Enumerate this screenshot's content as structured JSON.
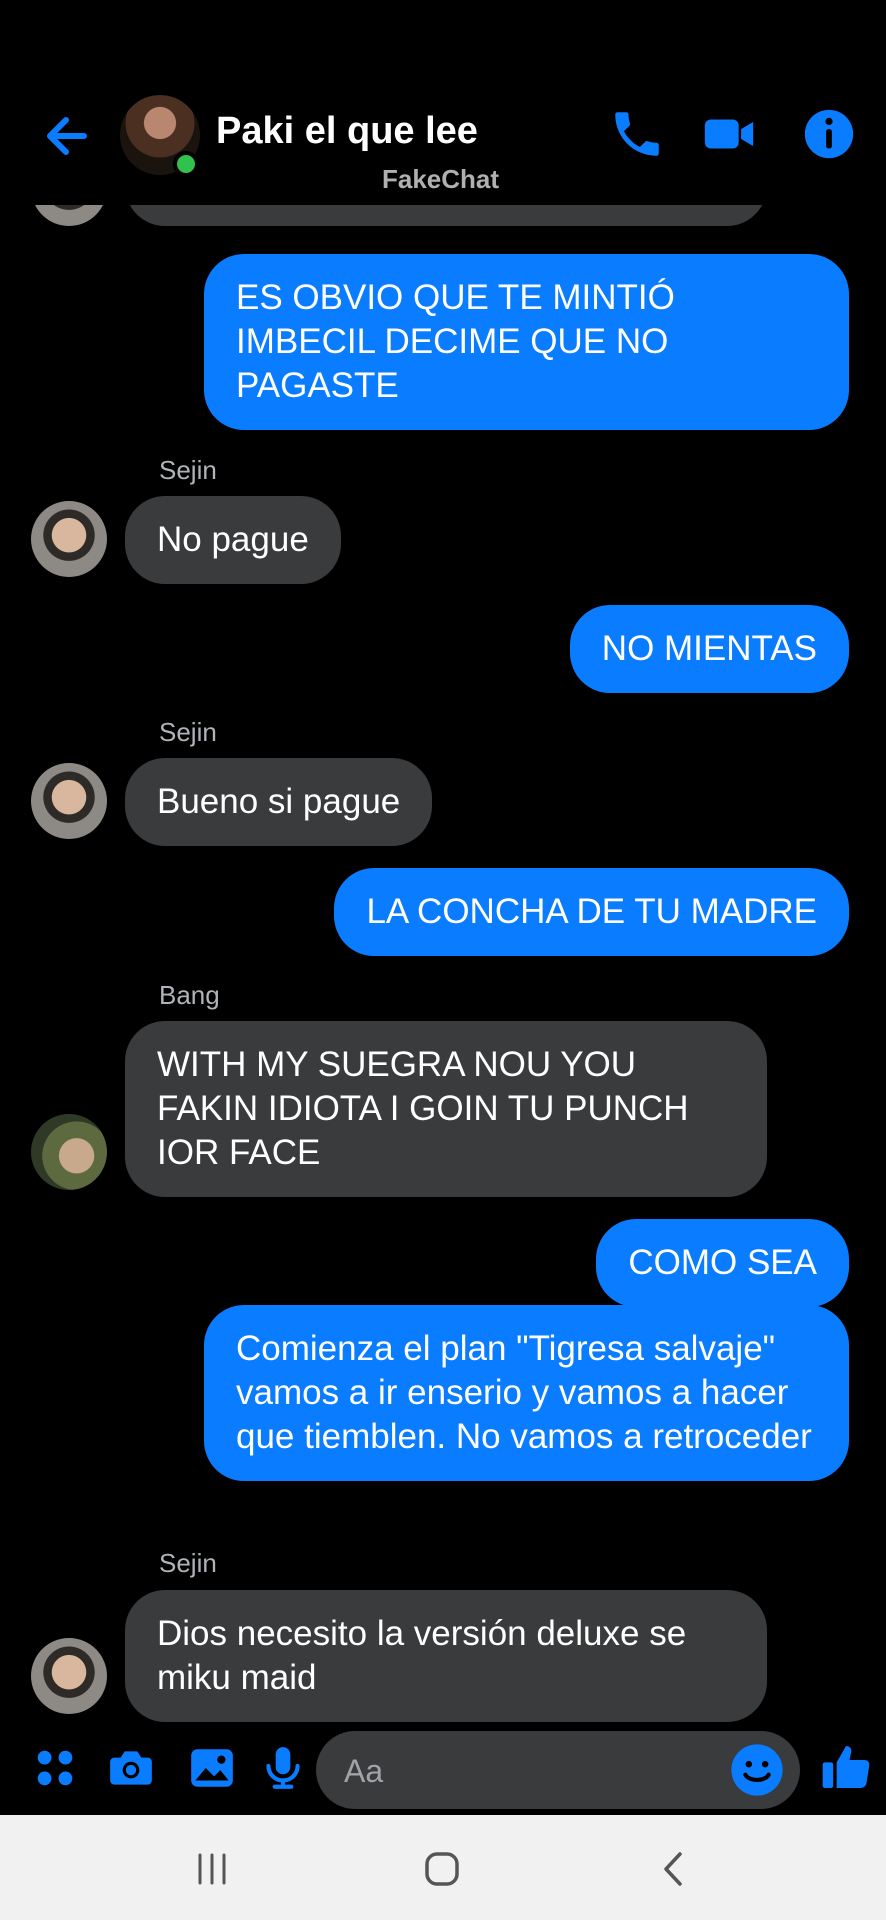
{
  "header": {
    "title": "Paki el que lee",
    "watermark": "FakeChat",
    "icons": [
      "back-arrow-icon",
      "phone-icon",
      "video-camera-icon",
      "info-icon"
    ],
    "accent": "#0a7cff"
  },
  "messages": [
    {
      "dir": "out",
      "text": "ES OBVIO QUE TE MINTIÓ IMBECIL DECIME QUE NO PAGASTE"
    },
    {
      "dir": "in",
      "sender": "Sejin",
      "text": "No pague"
    },
    {
      "dir": "out",
      "text": "NO MIENTAS"
    },
    {
      "dir": "in",
      "sender": "Sejin",
      "text": "Bueno si pague"
    },
    {
      "dir": "out",
      "text": "LA CONCHA DE TU MADRE"
    },
    {
      "dir": "in",
      "sender": "Bang",
      "text": "WITH MY SUEGRA NOU YOU FAKIN IDIOTA I GOIN TU PUNCH IOR FACE"
    },
    {
      "dir": "out",
      "text": "COMO SEA"
    },
    {
      "dir": "out",
      "text": "Comienza el plan \"Tigresa salvaje\" vamos a ir enserio y vamos a hacer que tiemblen. No vamos a retroceder"
    },
    {
      "dir": "in",
      "sender": "Sejin",
      "text": "Dios necesito la versión deluxe se miku maid"
    }
  ],
  "composer": {
    "placeholder": "Aa",
    "icons": [
      "apps-icon",
      "camera-icon",
      "gallery-icon",
      "microphone-icon",
      "emoji-icon",
      "thumbs-up-icon"
    ]
  },
  "navbar": {
    "icons": [
      "recent-apps-icon",
      "home-icon",
      "back-icon"
    ]
  },
  "colors": {
    "outgoing_bubble": "#0a7cff",
    "incoming_bubble": "#3a3b3c",
    "background": "#000000"
  }
}
